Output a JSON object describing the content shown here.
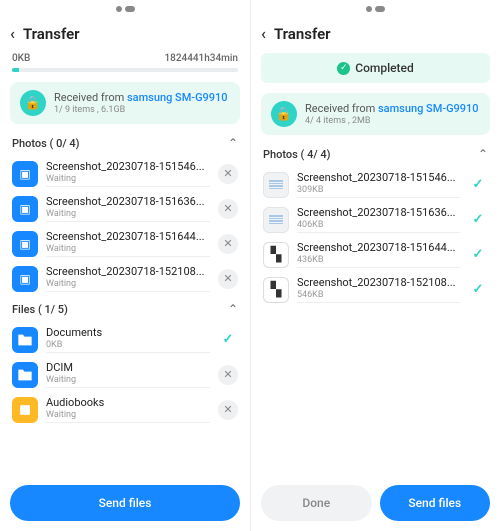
{
  "left": {
    "header_title": "Transfer",
    "progress_left": "0KB",
    "progress_right": "1824441h34min",
    "received_label": "Received from ",
    "received_device": "samsung SM-G9910",
    "received_meta": "1/ 9 items , 6.1GB",
    "photos_header": "Photos ( 0/ 4)",
    "photos": [
      {
        "name": "Screenshot_20230718-151546...",
        "status": "Waiting"
      },
      {
        "name": "Screenshot_20230718-151636...",
        "status": "Waiting"
      },
      {
        "name": "Screenshot_20230718-151644...",
        "status": "Waiting"
      },
      {
        "name": "Screenshot_20230718-152108...",
        "status": "Waiting"
      }
    ],
    "files_header": "Files ( 1/ 5)",
    "files": [
      {
        "name": "Documents",
        "sub": "0KB",
        "icon": "folder",
        "action": "done"
      },
      {
        "name": "DCIM",
        "sub": "Waiting",
        "icon": "folder",
        "action": "cancel"
      },
      {
        "name": "Audiobooks",
        "sub": "Waiting",
        "icon": "yellow",
        "action": "cancel"
      }
    ],
    "send_button": "Send files"
  },
  "right": {
    "header_title": "Transfer",
    "completed_label": "Completed",
    "received_label": "Received from ",
    "received_device": "samsung SM-G9910",
    "received_meta": "4/ 4 items , 2MB",
    "photos_header": "Photos ( 4/ 4)",
    "photos": [
      {
        "name": "Screenshot_20230718-151546...",
        "size": "309KB",
        "thumb": "lines"
      },
      {
        "name": "Screenshot_20230718-151636...",
        "size": "406KB",
        "thumb": "lines"
      },
      {
        "name": "Screenshot_20230718-151644...",
        "size": "436KB",
        "thumb": "qr"
      },
      {
        "name": "Screenshot_20230718-152108...",
        "size": "546KB",
        "thumb": "qr"
      }
    ],
    "done_button": "Done",
    "send_button": "Send files"
  }
}
